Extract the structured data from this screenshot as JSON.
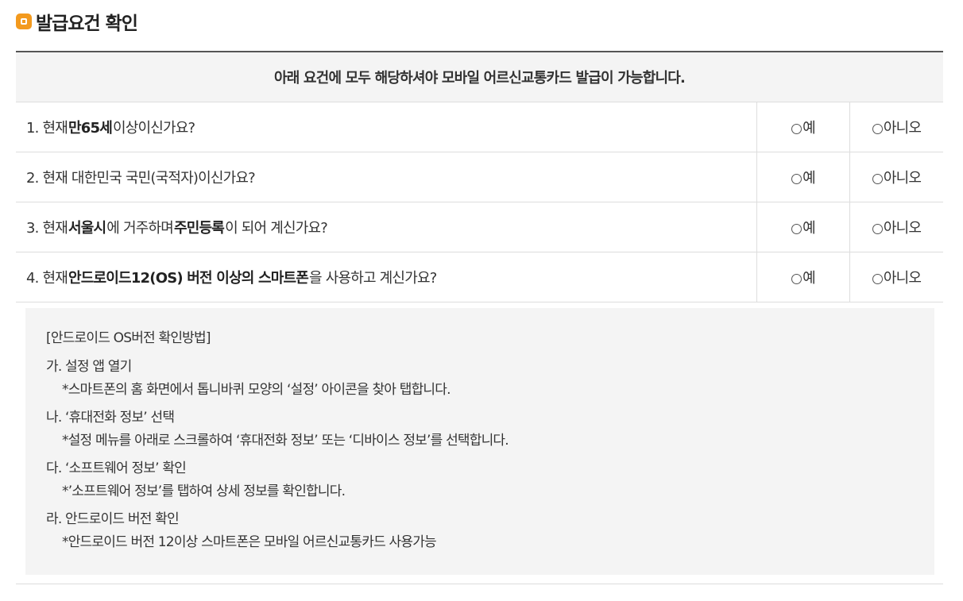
{
  "section": {
    "title": "발급요건 확인",
    "notice": "아래 요건에 모두 해당하셔야 모바일 어르신교통카드 발급이 가능합니다."
  },
  "options": {
    "yes": "예",
    "no": "아니오"
  },
  "questions": [
    {
      "parts": [
        {
          "text": "1. 현재 ",
          "bold": false
        },
        {
          "text": "만65세",
          "bold": true
        },
        {
          "text": " 이상이신가요?",
          "bold": false
        }
      ]
    },
    {
      "parts": [
        {
          "text": "2. 현재 대한민국 국민(국적자)이신가요?",
          "bold": false
        }
      ]
    },
    {
      "parts": [
        {
          "text": "3. 현재 ",
          "bold": false
        },
        {
          "text": "서울시",
          "bold": true
        },
        {
          "text": "에 거주하며 ",
          "bold": false
        },
        {
          "text": "주민등록",
          "bold": true
        },
        {
          "text": "이 되어 계신가요?",
          "bold": false
        }
      ]
    },
    {
      "parts": [
        {
          "text": "4. 현재 ",
          "bold": false
        },
        {
          "text": "안드로이드12(OS) 버전 이상의 스마트폰",
          "bold": true
        },
        {
          "text": "을 사용하고 계신가요?",
          "bold": false
        }
      ]
    }
  ],
  "guide": {
    "title": "[안드로이드 OS버전 확인방법]",
    "steps": [
      {
        "head": "가. 설정 앱 열기",
        "desc": "*스마트폰의 홈 화면에서 톱니바퀴 모양의 ‘설정’ 아이콘을 찾아 탭합니다."
      },
      {
        "head": "나. ‘휴대전화 정보’ 선택",
        "desc": "*설정 메뉴를 아래로 스크롤하여 ‘휴대전화 정보’ 또는 ‘디바이스 정보’를 선택합니다."
      },
      {
        "head": "다. ‘소프트웨어 정보’ 확인",
        "desc": "*’소프트웨어 정보’를 탭하여 상세 정보를 확인합니다."
      },
      {
        "head": "라. 안드로이드 버전 확인",
        "desc": "*안드로이드 버전 12이상 스마트폰은 모바일 어르신교통카드 사용가능"
      }
    ]
  },
  "colors": {
    "accent": "#f39a1e",
    "header_bg": "#f4f4f4",
    "border": "#dddddd",
    "top_border": "#555555"
  }
}
